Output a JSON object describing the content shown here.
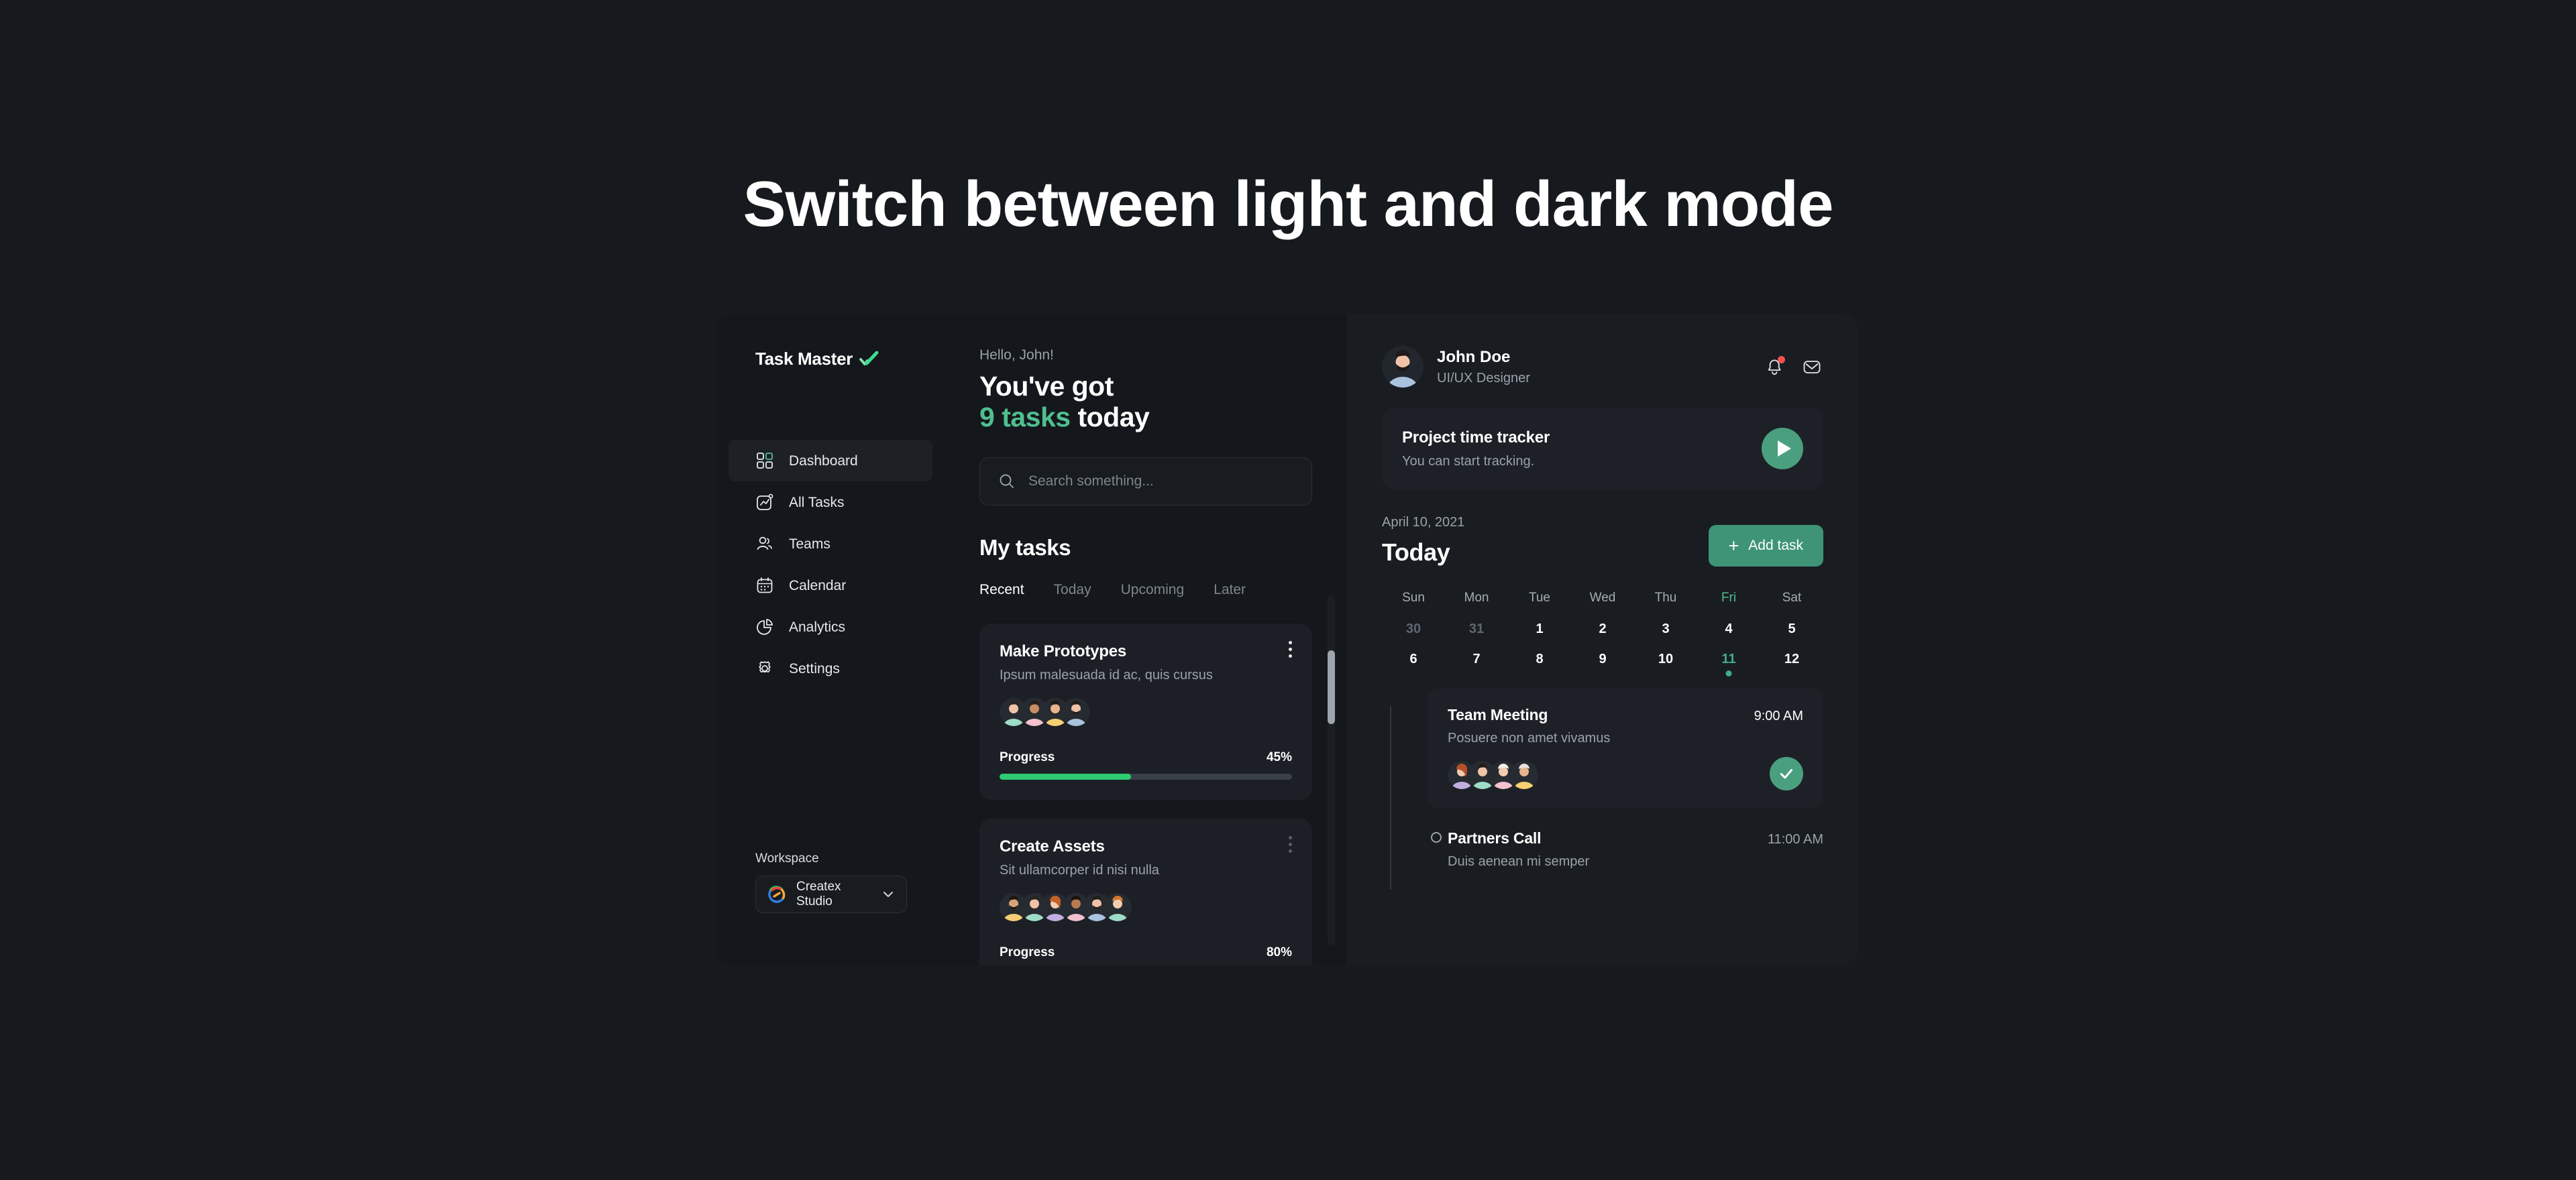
{
  "page": {
    "title": "Switch between light and dark mode"
  },
  "sidebar": {
    "brand": "Task Master",
    "brand_icon": "double-check-icon",
    "items": [
      {
        "label": "Dashboard",
        "icon": "grid-icon",
        "active": true
      },
      {
        "label": "All Tasks",
        "icon": "chart-square-icon",
        "active": false
      },
      {
        "label": "Teams",
        "icon": "users-icon",
        "active": false
      },
      {
        "label": "Calendar",
        "icon": "calendar-icon",
        "active": false
      },
      {
        "label": "Analytics",
        "icon": "pie-chart-icon",
        "active": false
      },
      {
        "label": "Settings",
        "icon": "gear-icon",
        "active": false
      }
    ],
    "workspace": {
      "label": "Workspace",
      "value": "Createx Studio",
      "chevron": "chevron-down-icon"
    }
  },
  "main": {
    "greeting": "Hello, John!",
    "headline_line1": "You've got",
    "headline_accent": "9 tasks",
    "headline_suffix": " today",
    "search": {
      "placeholder": "Search something...",
      "value": "",
      "icon": "search-icon"
    },
    "section_title": "My tasks",
    "tabs": [
      {
        "label": "Recent",
        "active": true
      },
      {
        "label": "Today",
        "active": false
      },
      {
        "label": "Upcoming",
        "active": false
      },
      {
        "label": "Later",
        "active": false
      }
    ],
    "tasks": [
      {
        "title": "Make Prototypes",
        "desc": "Ipsum malesuada id ac, quis cursus",
        "progress_label": "Progress",
        "progress_value": "45%",
        "progress_pct": 45,
        "avatars": [
          "#9fdcc8",
          "#f3c0ce",
          "#f6cf73",
          "#a9c3de"
        ]
      },
      {
        "title": "Create Assets",
        "desc": "Sit ullamcorper id nisi nulla",
        "progress_label": "Progress",
        "progress_value": "80%",
        "progress_pct": 80,
        "avatars": [
          "#f6cf73",
          "#9fdcc8",
          "#c3aee0",
          "#f3c0ce",
          "#a9c3de",
          "#9fdcc8"
        ]
      }
    ]
  },
  "right": {
    "profile": {
      "name": "John Doe",
      "role": "UI/UX Designer",
      "avatar": "avatar-john",
      "notification_icon": "bell-icon",
      "message_icon": "envelope-icon",
      "notification_badge_color": "#f4524d"
    },
    "tracker": {
      "title": "Project time tracker",
      "subtitle": "You can start tracking.",
      "play_icon": "play-icon"
    },
    "day_header": {
      "date": "April 10, 2021",
      "title": "Today",
      "add_button": "Add task",
      "add_icon": "plus-icon"
    },
    "calendar": {
      "dow": [
        "Sun",
        "Mon",
        "Tue",
        "Wed",
        "Thu",
        "Fri",
        "Sat"
      ],
      "highlight_dow": "Fri",
      "week1": [
        "30",
        "31",
        "1",
        "2",
        "3",
        "4",
        "5"
      ],
      "week1_muted": [
        "30",
        "31"
      ],
      "week2": [
        "6",
        "7",
        "8",
        "9",
        "10",
        "11",
        "12"
      ],
      "selected_day": "11"
    },
    "events": [
      {
        "title": "Team Meeting",
        "time": "9:00 AM",
        "desc": "Posuere non amet vivamus",
        "avatars": [
          "#c3aee0",
          "#9fdcc8",
          "#f3c0ce",
          "#f6cf73"
        ],
        "check_icon": "check-icon"
      },
      {
        "title": "Partners Call",
        "time": "11:00 AM",
        "desc": "Duis aenean mi semper"
      }
    ]
  },
  "colors": {
    "accent_green": "#4fbf8f",
    "button_green": "#3f9478",
    "progress_green": "#2ecc71",
    "page_bg": "#16191d",
    "panel_bg": "#14171b",
    "right_panel_bg": "#191d22",
    "card_bg": "#1c2026"
  }
}
